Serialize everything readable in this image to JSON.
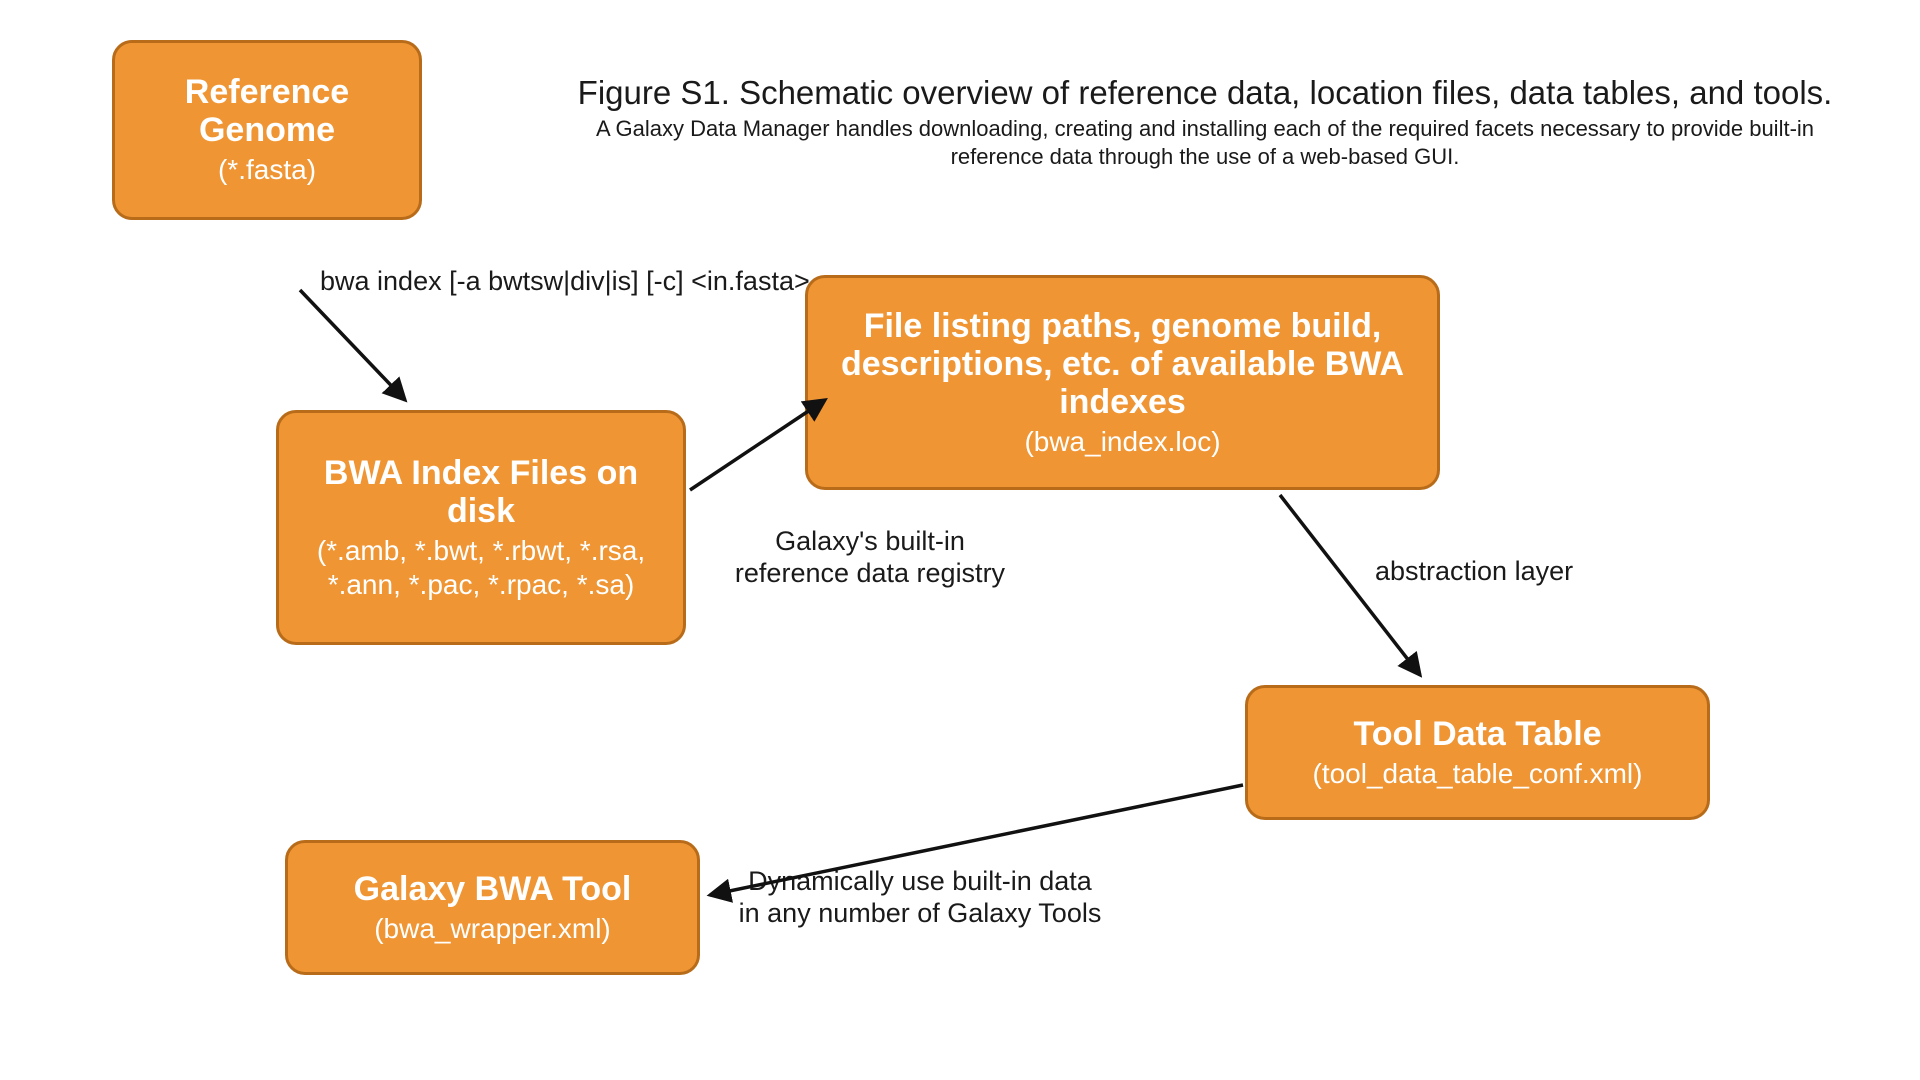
{
  "figure": {
    "title": "Figure S1. Schematic overview of reference data, location files, data tables, and tools.",
    "description": "A Galaxy Data Manager handles downloading, creating and installing each of the required facets necessary to provide built-in reference data through the use of a web-based GUI."
  },
  "nodes": {
    "reference_genome": {
      "title": "Reference Genome",
      "subtitle": "(*.fasta)"
    },
    "bwa_index_files": {
      "title": "BWA Index Files on disk",
      "subtitle": "(*.amb, *.bwt, *.rbwt, *.rsa, *.ann, *.pac, *.rpac, *.sa)"
    },
    "file_listing": {
      "title": "File listing paths, genome build, descriptions, etc. of available BWA indexes",
      "subtitle": "(bwa_index.loc)"
    },
    "tool_data_table": {
      "title": "Tool Data Table",
      "subtitle": "(tool_data_table_conf.xml)"
    },
    "galaxy_bwa_tool": {
      "title": "Galaxy BWA Tool",
      "subtitle": "(bwa_wrapper.xml)"
    }
  },
  "edges": {
    "e1": {
      "label": "bwa index [-a bwtsw|div|is] [-c] <in.fasta>"
    },
    "e2": {
      "label": "Galaxy's built-in reference data registry"
    },
    "e3": {
      "label": "abstraction layer"
    },
    "e4": {
      "label": "Dynamically use built-in data in any number of Galaxy Tools"
    }
  }
}
